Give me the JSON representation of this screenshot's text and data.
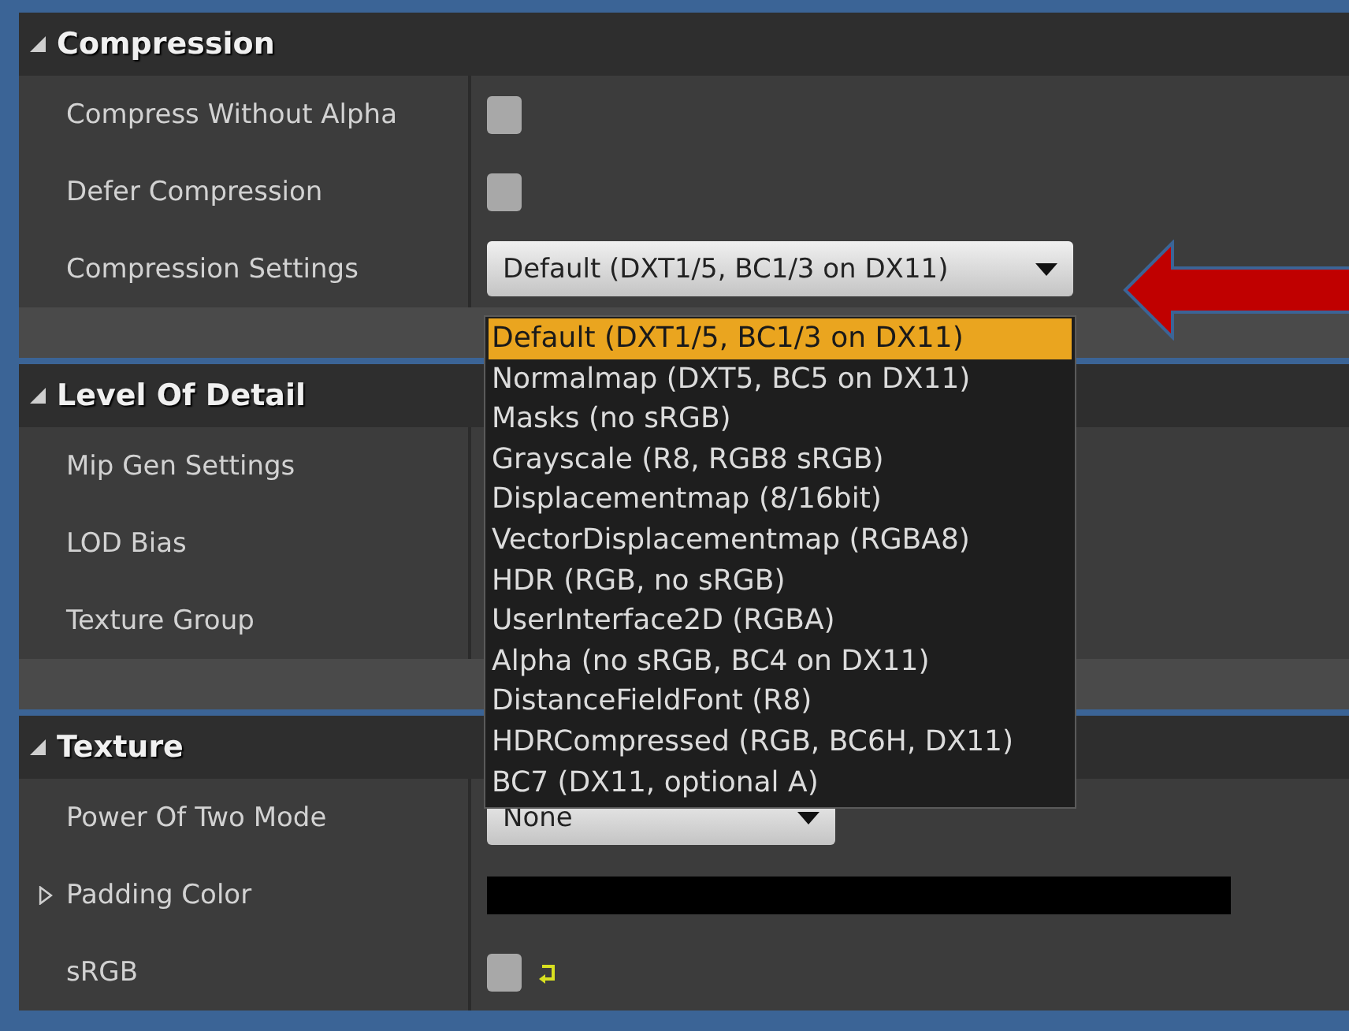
{
  "sections": [
    {
      "title": "Compression",
      "expanded": true,
      "footer": true,
      "rows": [
        {
          "label": "Compress Without Alpha",
          "kind": "checkbox",
          "checked": false
        },
        {
          "label": "Defer Compression",
          "kind": "checkbox",
          "checked": false
        },
        {
          "label": "Compression Settings",
          "kind": "combo",
          "value": "Default (DXT1/5, BC1/3 on DX11)",
          "open": true
        }
      ]
    },
    {
      "title": "Level Of Detail",
      "expanded": true,
      "footer": true,
      "rows": [
        {
          "label": "Mip Gen Settings",
          "kind": "hidden"
        },
        {
          "label": "LOD Bias",
          "kind": "hidden"
        },
        {
          "label": "Texture Group",
          "kind": "hidden"
        }
      ]
    },
    {
      "title": "Texture",
      "expanded": true,
      "footer": false,
      "rows": [
        {
          "label": "Power Of Two Mode",
          "kind": "combo",
          "value": "None",
          "open": false
        },
        {
          "label": "Padding Color",
          "kind": "swatch",
          "color": "#000000",
          "expandable": true
        },
        {
          "label": "sRGB",
          "kind": "checkbox",
          "checked": false,
          "reset": true
        }
      ]
    }
  ],
  "dropdown": {
    "items": [
      {
        "label": "Default (DXT1/5, BC1/3 on DX11)",
        "selected": true
      },
      {
        "label": "Normalmap (DXT5, BC5 on DX11)",
        "selected": false
      },
      {
        "label": "Masks (no sRGB)",
        "selected": false
      },
      {
        "label": "Grayscale (R8, RGB8 sRGB)",
        "selected": false
      },
      {
        "label": "Displacementmap (8/16bit)",
        "selected": false
      },
      {
        "label": "VectorDisplacementmap (RGBA8)",
        "selected": false
      },
      {
        "label": "HDR (RGB, no sRGB)",
        "selected": false
      },
      {
        "label": "UserInterface2D (RGBA)",
        "selected": false
      },
      {
        "label": "Alpha (no sRGB, BC4 on DX11)",
        "selected": false
      },
      {
        "label": "DistanceFieldFont (R8)",
        "selected": false
      },
      {
        "label": "HDRCompressed (RGB, BC6H, DX11)",
        "selected": false
      },
      {
        "label": "BC7 (DX11, optional A)",
        "selected": false
      }
    ]
  }
}
